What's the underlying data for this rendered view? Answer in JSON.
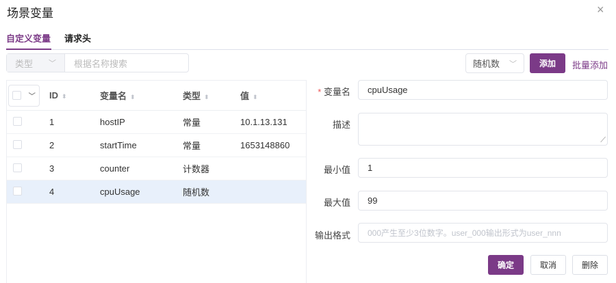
{
  "dialog": {
    "title": "场景变量",
    "close_icon": "close-icon"
  },
  "tabs": [
    {
      "label": "自定义变量",
      "active": true
    },
    {
      "label": "请求头",
      "active": false
    }
  ],
  "filter": {
    "type_label": "类型",
    "search_placeholder": "根据名称搜索"
  },
  "toolbar": {
    "type_select": "随机数",
    "add_label": "添加",
    "batch_add_label": "批量添加"
  },
  "table": {
    "headers": [
      "ID",
      "变量名",
      "类型",
      "值"
    ],
    "rows": [
      {
        "id": "1",
        "name": "hostIP",
        "type": "常量",
        "value": "10.1.13.131"
      },
      {
        "id": "2",
        "name": "startTime",
        "type": "常量",
        "value": "1653148860"
      },
      {
        "id": "3",
        "name": "counter",
        "type": "计数器",
        "value": ""
      },
      {
        "id": "4",
        "name": "cpuUsage",
        "type": "随机数",
        "value": "",
        "selected": true
      }
    ]
  },
  "form": {
    "name_label": "变量名",
    "required_mark": "*",
    "name_value": "cpuUsage",
    "desc_label": "描述",
    "desc_value": "",
    "min_label": "最小值",
    "min_value": "1",
    "max_label": "最大值",
    "max_value": "99",
    "format_label": "输出格式",
    "format_placeholder": "000产生至少3位数字。user_000输出形式为user_nnn",
    "confirm_label": "确定",
    "cancel_label": "取消",
    "delete_label": "删除"
  },
  "colors": {
    "accent": "#7b3a87",
    "selected_row": "#e8f0fb"
  }
}
